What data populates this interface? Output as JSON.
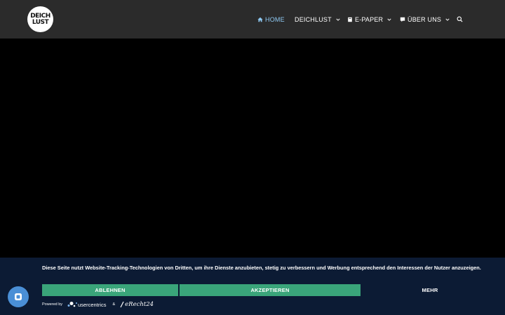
{
  "logo": {
    "line1": "DEICH",
    "line2": "LUST"
  },
  "nav": {
    "home": "HOME",
    "deichlust": "DEICHLUST",
    "epaper": "E-PAPER",
    "ueber_uns": "ÜBER UNS"
  },
  "consent": {
    "text": "Diese Seite nutzt Website-Tracking-Technologien von Dritten, um ihre Dienste anzubieten, stetig zu verbessern und Werbung entsprechend den Interessen der Nutzer anzuzeigen.",
    "decline_label": "ABLEHNEN",
    "accept_label": "AKZEPTIEREN",
    "more_label": "MEHR",
    "powered_by": "Powered by",
    "usercentrics": "usercentrics",
    "ampersand": "&",
    "erecht": "eRecht24"
  },
  "colors": {
    "header_bg": "#2b2b2b",
    "active_nav": "#8ec8f2",
    "consent_bg": "#0c1b34",
    "button_green": "#3aa57a",
    "fab_blue": "#4a8fd6"
  }
}
